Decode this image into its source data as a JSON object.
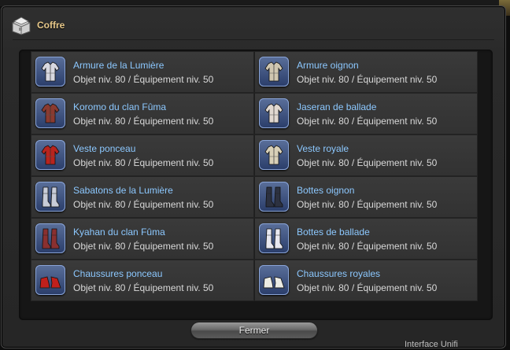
{
  "window": {
    "title": "Coffre",
    "close_label": "Fermer"
  },
  "colors": {
    "title": "#e8c98a",
    "item_name": "#8cc8ff",
    "item_meta": "#d8d8d8"
  },
  "items": [
    {
      "name": "Armure de la Lumière",
      "meta": "Objet niv. 80 / Équipement niv. 50",
      "icon": "body-armor-icon",
      "tint": "#d8d8e0"
    },
    {
      "name": "Armure oignon",
      "meta": "Objet niv. 80 / Équipement niv. 50",
      "icon": "body-armor-icon",
      "tint": "#cfc6b0"
    },
    {
      "name": "Koromo du clan Fûma",
      "meta": "Objet niv. 80 / Équipement niv. 50",
      "icon": "body-armor-icon",
      "tint": "#8a3a30"
    },
    {
      "name": "Jaseran de ballade",
      "meta": "Objet niv. 80 / Équipement niv. 50",
      "icon": "body-armor-icon",
      "tint": "#e0d8d0"
    },
    {
      "name": "Veste ponceau",
      "meta": "Objet niv. 80 / Équipement niv. 50",
      "icon": "body-armor-icon",
      "tint": "#b8241e"
    },
    {
      "name": "Veste royale",
      "meta": "Objet niv. 80 / Équipement niv. 50",
      "icon": "body-armor-icon",
      "tint": "#d8d0b8"
    },
    {
      "name": "Sabatons de la Lumière",
      "meta": "Objet niv. 80 / Équipement niv. 50",
      "icon": "boots-icon",
      "tint": "#c8ccd8"
    },
    {
      "name": "Bottes oignon",
      "meta": "Objet niv. 80 / Équipement niv. 50",
      "icon": "boots-icon",
      "tint": "#2c3140"
    },
    {
      "name": "Kyahan du clan Fûma",
      "meta": "Objet niv. 80 / Équipement niv. 50",
      "icon": "boots-icon",
      "tint": "#8a3030"
    },
    {
      "name": "Bottes de ballade",
      "meta": "Objet niv. 80 / Équipement niv. 50",
      "icon": "boots-icon",
      "tint": "#e8e8f0"
    },
    {
      "name": "Chaussures ponceau",
      "meta": "Objet niv. 80 / Équipement niv. 50",
      "icon": "shoes-icon",
      "tint": "#c0201c"
    },
    {
      "name": "Chaussures royales",
      "meta": "Objet niv. 80 / Équipement niv. 50",
      "icon": "shoes-icon",
      "tint": "#ecece4"
    }
  ],
  "background_peek": "Interface Unifi"
}
